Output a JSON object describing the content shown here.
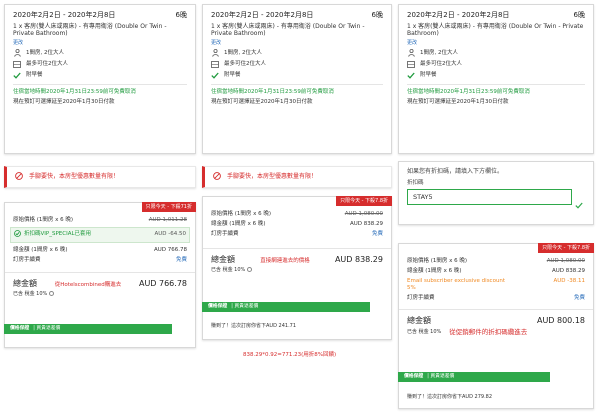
{
  "booking": {
    "dates": "2020年2月2日 - 2020年2月8日",
    "nights": "6晚",
    "room": "1 x 客房(雙人床或兩床) - 有專用衛浴 (Double Or Twin - Private Bathroom)",
    "change": "更改",
    "beds": "1間房, 2位大人",
    "guests": "最多可住2位大人",
    "breakfast": "附早餐",
    "free_cancel": "住宿當地時間2020年1月31日23:59前可免費取消",
    "pay_later": "現在預訂可選擇延至2020年1月30日付款"
  },
  "alert": {
    "text": "手腳要快，本房型優惠數量有限！"
  },
  "badges": {
    "p1": "只限今天 - 下殺71折",
    "p2": "只限今天 - 下殺7.8折",
    "p3": "只限今天 - 下殺7.8折"
  },
  "p1": {
    "orig_label": "原始價格 (1間房 x 6 晚)",
    "orig_val": "AUD 1,011.28",
    "promo_label": "折扣碼VIP_SPECIAL已套用",
    "promo_val": "AUD -64.50",
    "sub_label": "總金額 (1間房 x 6 晚)",
    "sub_val": "AUD 766.78",
    "fee_label": "訂房手續費",
    "fee_val": "免費",
    "total_label": "總金額",
    "anno": "從Hotelscombined購進去",
    "total_val": "AUD 766.78",
    "tax": "已含 稅金 10%",
    "guarantee_bold": "價格保證",
    "guarantee_text": "| 買貴退差價",
    "saved": ""
  },
  "p2": {
    "orig_label": "原始價格 (1間房 x 6 晚)",
    "orig_val": "AUD 1,080.00",
    "sub_label": "總金額 (1間房 x 6 晚)",
    "sub_val": "AUD 838.29",
    "fee_label": "訂房手續費",
    "fee_val": "免費",
    "total_label": "總金額",
    "anno": "直接網連進去的價格",
    "total_val": "AUD 838.29",
    "tax": "已含 稅金 10%",
    "guarantee_bold": "價格保證",
    "guarantee_text": "| 買貴退差價",
    "saved": "賺到了！這次訂房你省下AUD 241.71"
  },
  "p3": {
    "orig_label": "原始價格 (1間房 x 6 晚)",
    "orig_val": "AUD 1,080.00",
    "sub_label": "總金額 (1間房 x 6 晚)",
    "sub_val": "AUD 838.29",
    "email_label": "Email subscriber exclusive discount 5%",
    "email_val": "AUD -38.11",
    "fee_label": "訂房手續費",
    "fee_val": "免費",
    "total_label": "總金額",
    "total_val": "AUD 800.18",
    "tax": "已含 稅金 10%",
    "anno": "從促銷郵件的折扣碼纜進去",
    "guarantee_bold": "價格保證",
    "guarantee_text": "| 買貴退差價",
    "saved": "賺到了！這次訂房你省下AUD 279.82"
  },
  "coupon": {
    "question": "如果您有折扣碼，請填入下方欄位。",
    "label": "折扣碼",
    "value": "STAY5"
  },
  "footnote": "838.29*0.92=771.23(用折8%回饋)",
  "colors": {
    "green": "#2ea84a",
    "red": "#d62d2d",
    "link": "#2a6ebb",
    "orange": "#f08a24"
  }
}
